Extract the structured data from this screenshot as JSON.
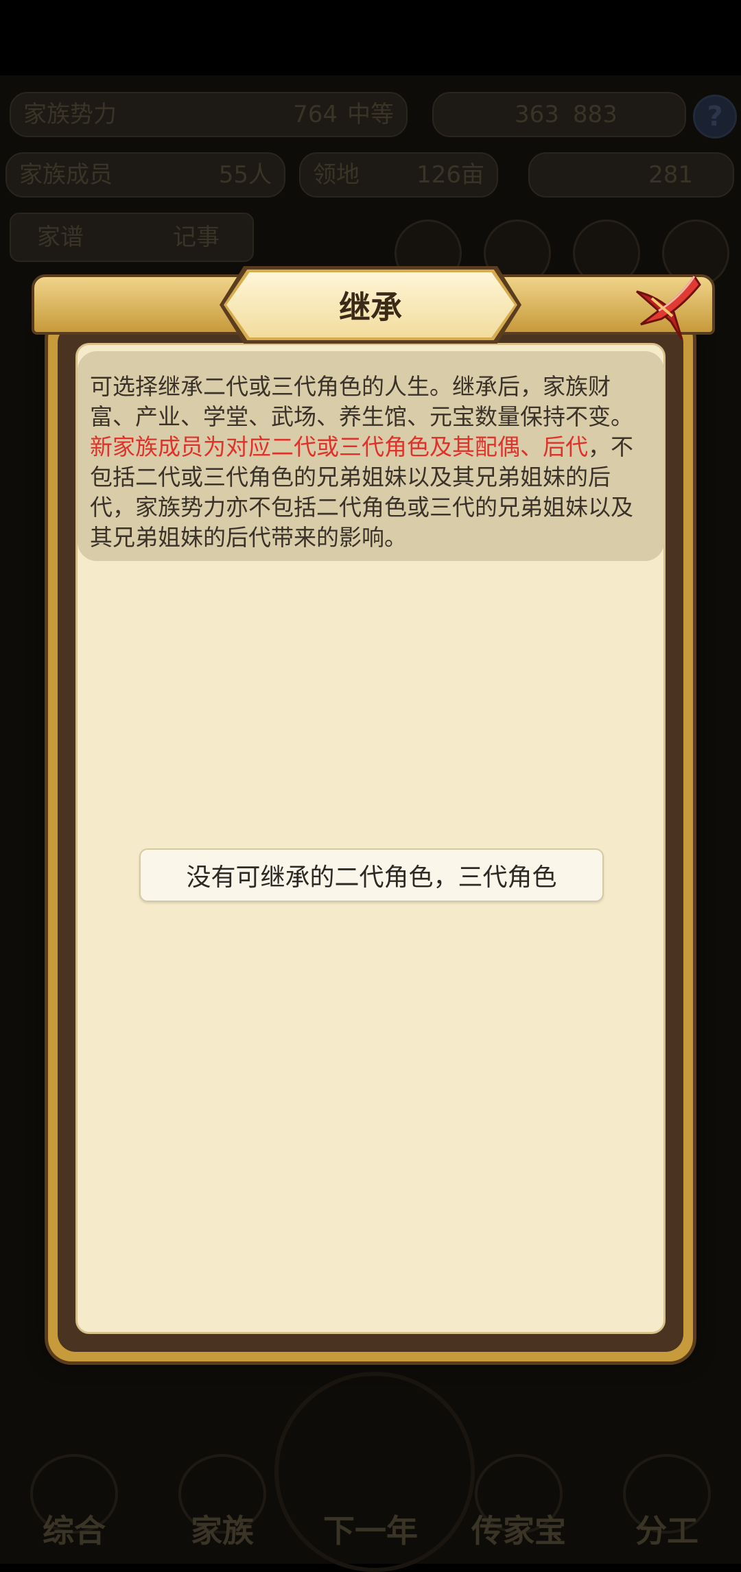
{
  "background": {
    "top_bar": {
      "power_label": "家族势力",
      "power_value": "764",
      "power_badge": "中等",
      "resource_left": "363",
      "resource_right": "883"
    },
    "second_bar": {
      "members_label": "家族成员",
      "members_value": "55人",
      "land_label": "领地",
      "land_value": "126亩",
      "gold_value": "281"
    },
    "third_bar": {
      "left_label": "家谱",
      "right_label": "记事"
    },
    "nav": [
      "综合",
      "家族",
      "下一年",
      "传家宝",
      "分工"
    ]
  },
  "modal": {
    "title": "继承",
    "description_normal_1": "可选择继承二代或三代角色的人生。继承后，家族财富、产业、学堂、武场、养生馆、元宝数量保持不变。",
    "description_highlight": "新家族成员为对应二代或三代角色及其配偶、后代",
    "description_normal_2": "，不包括二代或三代角色的兄弟姐妹以及其兄弟姐妹的后代，家族势力亦不包括二代角色或三代的兄弟姐妹以及其兄弟姐妹的后代带来的影响。",
    "empty_message": "没有可继承的二代角色，三代角色"
  },
  "colors": {
    "highlight_red": "#e0312b",
    "paper": "#f5ebca",
    "frame_gold": "#c79a3b",
    "close_red": "#d8322e"
  }
}
